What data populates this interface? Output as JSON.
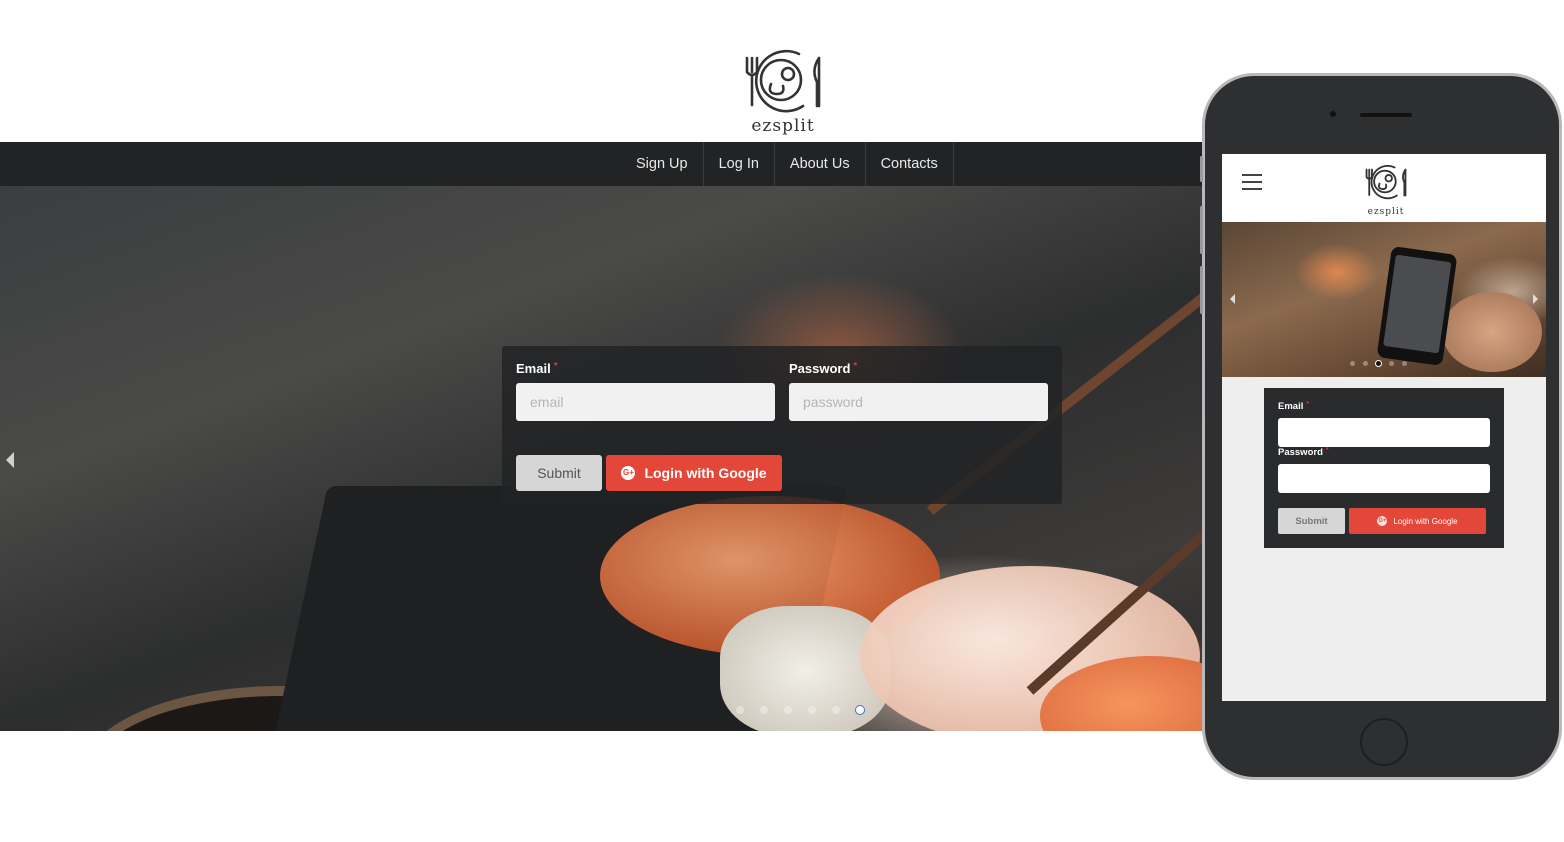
{
  "brand": {
    "name": "ezsplit"
  },
  "nav": {
    "items": [
      "Sign Up",
      "Log In",
      "About Us",
      "Contacts"
    ]
  },
  "carousel": {
    "slide_count": 6,
    "active_index": 5
  },
  "login": {
    "email_label": "Email",
    "email_placeholder": "email",
    "password_label": "Password",
    "password_placeholder": "password",
    "required_mark": "*",
    "submit_label": "Submit",
    "google_label": "Login with Google",
    "google_icon_text": "G+"
  },
  "mobile": {
    "brand": "ezsplit",
    "carousel": {
      "slide_count": 5,
      "active_index": 2
    },
    "email_label": "Email",
    "password_label": "Password",
    "required_mark": "*",
    "submit_label": "Submit",
    "google_label": "Login with Google",
    "google_icon_text": "G+"
  },
  "colors": {
    "navbar": "#222325",
    "google": "#e2473a",
    "required": "#e0382e",
    "phone_body": "#2e2f31"
  },
  "icons": [
    "fork-icon",
    "knife-icon",
    "plate-icon",
    "hamburger-menu-icon",
    "google-plus-icon",
    "chevron-left-icon",
    "chevron-right-icon"
  ]
}
